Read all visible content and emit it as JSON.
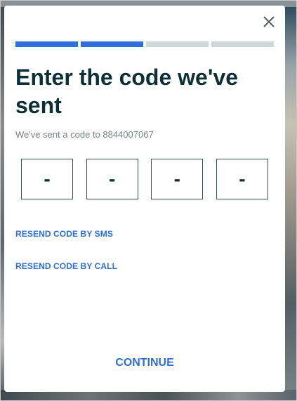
{
  "modal": {
    "title": "Enter the code we've sent",
    "subtitle": "We've sent a code to 8844007067",
    "close_icon": "close-icon",
    "progress": {
      "total_steps": 4,
      "completed_steps": 2,
      "active_color": "#2e6fdb",
      "inactive_color": "#cfd7d9"
    },
    "code_inputs": [
      {
        "placeholder": "-",
        "value": ""
      },
      {
        "placeholder": "-",
        "value": ""
      },
      {
        "placeholder": "-",
        "value": ""
      },
      {
        "placeholder": "-",
        "value": ""
      }
    ],
    "resend_sms_label": "RESEND CODE BY SMS",
    "resend_call_label": "RESEND CODE BY CALL",
    "continue_label": "CONTINUE"
  },
  "colors": {
    "accent": "#2e6fdb",
    "title_text": "#0c3035",
    "muted_text": "#7c8286"
  }
}
